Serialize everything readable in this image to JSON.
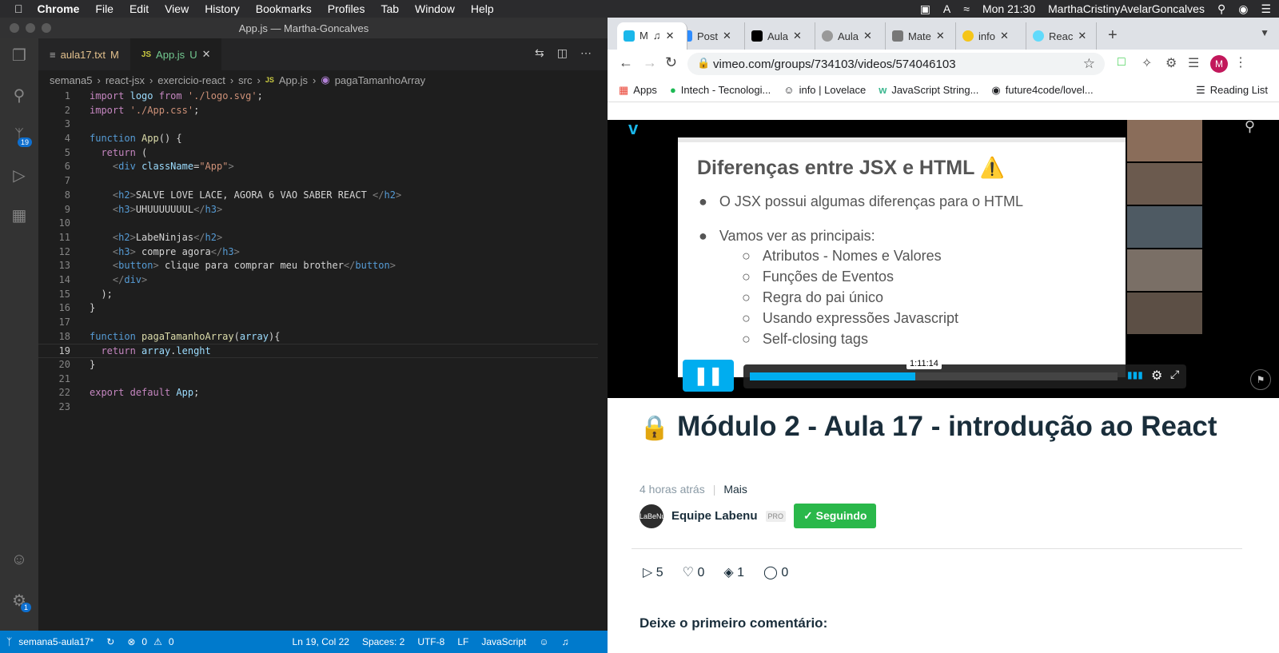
{
  "menubar": {
    "app": "Chrome",
    "items": [
      "File",
      "Edit",
      "View",
      "History",
      "Bookmarks",
      "Profiles",
      "Tab",
      "Window",
      "Help"
    ],
    "clock": "Mon 21:30",
    "user": "MarthaCristinyAvelarGoncalves"
  },
  "vscode": {
    "title": "App.js — Martha-Goncalves",
    "tabs": [
      {
        "label": "aula17.txt",
        "status": "M",
        "icon": "document-icon"
      },
      {
        "label": "App.js",
        "status": "U",
        "icon": "JS"
      }
    ],
    "breadcrumb": [
      "semana5",
      "react-jsx",
      "exercicio-react",
      "src",
      "App.js",
      "pagaTamanhoArray"
    ],
    "breadcrumb_js": "JS",
    "badges": {
      "source_control": "19",
      "settings": "1"
    },
    "status": {
      "branch": "semana5-aula17*",
      "errors": "0",
      "warnings": "0",
      "position": "Ln 19, Col 22",
      "spaces": "Spaces: 2",
      "encoding": "UTF-8",
      "eol": "LF",
      "language": "JavaScript"
    },
    "current_line": 19
  },
  "chrome": {
    "tabs": [
      "Post",
      "Aula",
      "Aula",
      "Mate",
      "info",
      "M",
      "Reac"
    ],
    "url": "vimeo.com/groups/734103/videos/574046103",
    "avatar_letter": "M",
    "bookmarks": [
      "Apps",
      "Intech - Tecnologi...",
      "info | Lovelace",
      "JavaScript String...",
      "future4code/lovel..."
    ],
    "reading_list": "Reading List"
  },
  "slide": {
    "heading": "Diferenças entre JSX e HTML ⚠️",
    "bullet1": "O JSX possui algumas diferenças para o HTML",
    "bullet2": "Vamos ver as principais:",
    "subitems": [
      "Atributos - Nomes e Valores",
      "Funções de Eventos",
      "Regra do pai único",
      "Usando expressões Javascript",
      "Self-closing tags"
    ]
  },
  "player": {
    "time": "1:11:14",
    "progress": 0.45
  },
  "video": {
    "title": "Módulo 2 - Aula 17 - introdução ao React",
    "time_ago": "4 horas atrás",
    "more": "Mais",
    "owner": "Equipe Labenu",
    "owner_badge": "PRO",
    "follow": "✓ Seguindo",
    "avatar_text": "LaBeNu",
    "plays": "5",
    "likes": "0",
    "collections": "1",
    "comments": "0",
    "comment_prompt": "Deixe o primeiro comentário:"
  }
}
